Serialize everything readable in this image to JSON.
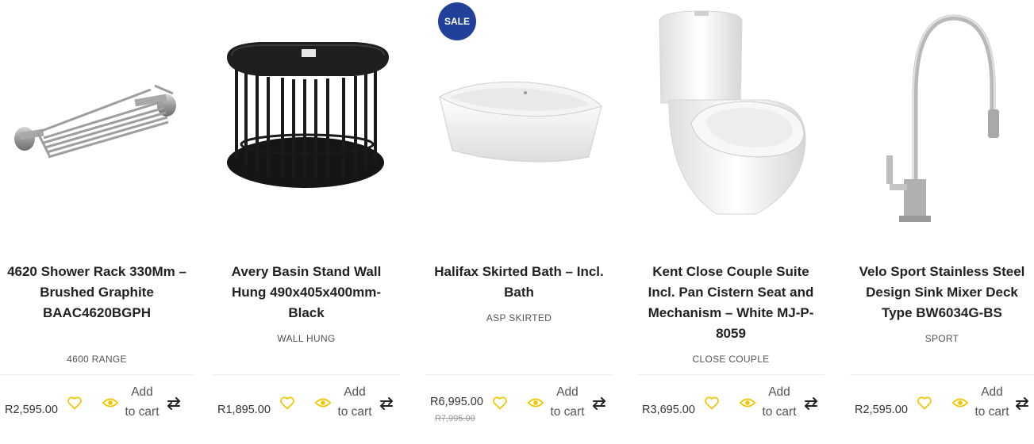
{
  "products": [
    {
      "title": "4620 Shower Rack 330Mm – Brushed Graphite BAAC4620BGPH",
      "category": "4600 RANGE",
      "price": "R2,595.00",
      "add_to_cart": "Add to cart"
    },
    {
      "title": "Avery Basin Stand Wall Hung 490x405x400mm-Black",
      "category": "WALL HUNG",
      "price": "R1,895.00",
      "add_to_cart": "Add to cart"
    },
    {
      "title": "Halifax Skirted Bath – Incl. Bath",
      "category": "ASP SKIRTED",
      "price": "R6,995.00",
      "old_price": "R7,995.00",
      "badge": "SALE",
      "add_to_cart": "Add to cart"
    },
    {
      "title": "Kent Close Couple Suite Incl. Pan Cistern Seat and Mechanism – White MJ-P-8059",
      "category": "CLOSE COUPLE",
      "price": "R3,695.00",
      "add_to_cart": "Add to cart"
    },
    {
      "title": "Velo Sport Stainless Steel Design Sink Mixer Deck Type BW6034G-BS",
      "category": "SPORT",
      "price": "R2,595.00",
      "add_to_cart": "Add to cart"
    }
  ],
  "icons": {
    "wishlist": "heart-icon",
    "quickview": "eye-icon",
    "compare": "compare-arrows-icon"
  },
  "colors": {
    "icon_yellow": "#f2c500",
    "sale_badge": "#21409a"
  }
}
